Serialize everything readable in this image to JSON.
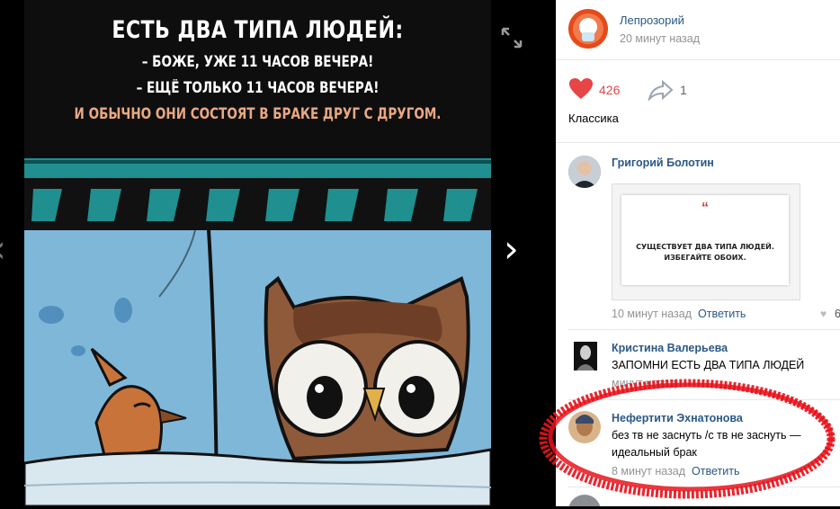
{
  "poster": {
    "title": "ЕСТЬ ДВА ТИПА ЛЮДЕЙ:",
    "line1": "– БОЖЕ, УЖЕ 11 ЧАСОВ ВЕЧЕРА!",
    "line2": "– ЕЩЁ ТОЛЬКО 11 ЧАСОВ ВЕЧЕРА!",
    "line3": "И ОБЫЧНО ОНИ СОСТОЯТ В БРАКЕ ДРУГ С ДРУГОМ."
  },
  "viewer": {
    "next_icon": "chevron-right-icon",
    "prev_icon": "chevron-left-icon",
    "expand_icon": "expand-icon"
  },
  "post": {
    "group_name": "Лепрозорий",
    "time": "20 минут назад",
    "likes": "426",
    "shares": "1",
    "text": "Классика"
  },
  "comments": [
    {
      "author": "Григорий Болотин",
      "attachment_lines": [
        "СУЩЕСТВУЕТ ДВА ТИПА ЛЮДЕЙ.",
        "ИЗБЕГАЙТЕ ОБОИХ."
      ],
      "time": "10 минут назад",
      "reply": "Ответить",
      "likes": "6"
    },
    {
      "author": "Кристина Валерьева",
      "text": "ЗАПОМНИ ЕСТЬ ДВА ТИПА ЛЮДЕЙ",
      "time": "минут назад"
    },
    {
      "author": "Нефертити Эхнатонова",
      "text_line1": "без тв не заснуть /с тв не заснуть —",
      "text_line2": "идеальный брак",
      "time": "8 минут назад",
      "reply": "Ответить"
    }
  ],
  "colors": {
    "link": "#2a5885",
    "like": "#e64646",
    "highlight": "#e8141c",
    "sky": "#7fb7d9",
    "teal": "#1f8f8f"
  }
}
